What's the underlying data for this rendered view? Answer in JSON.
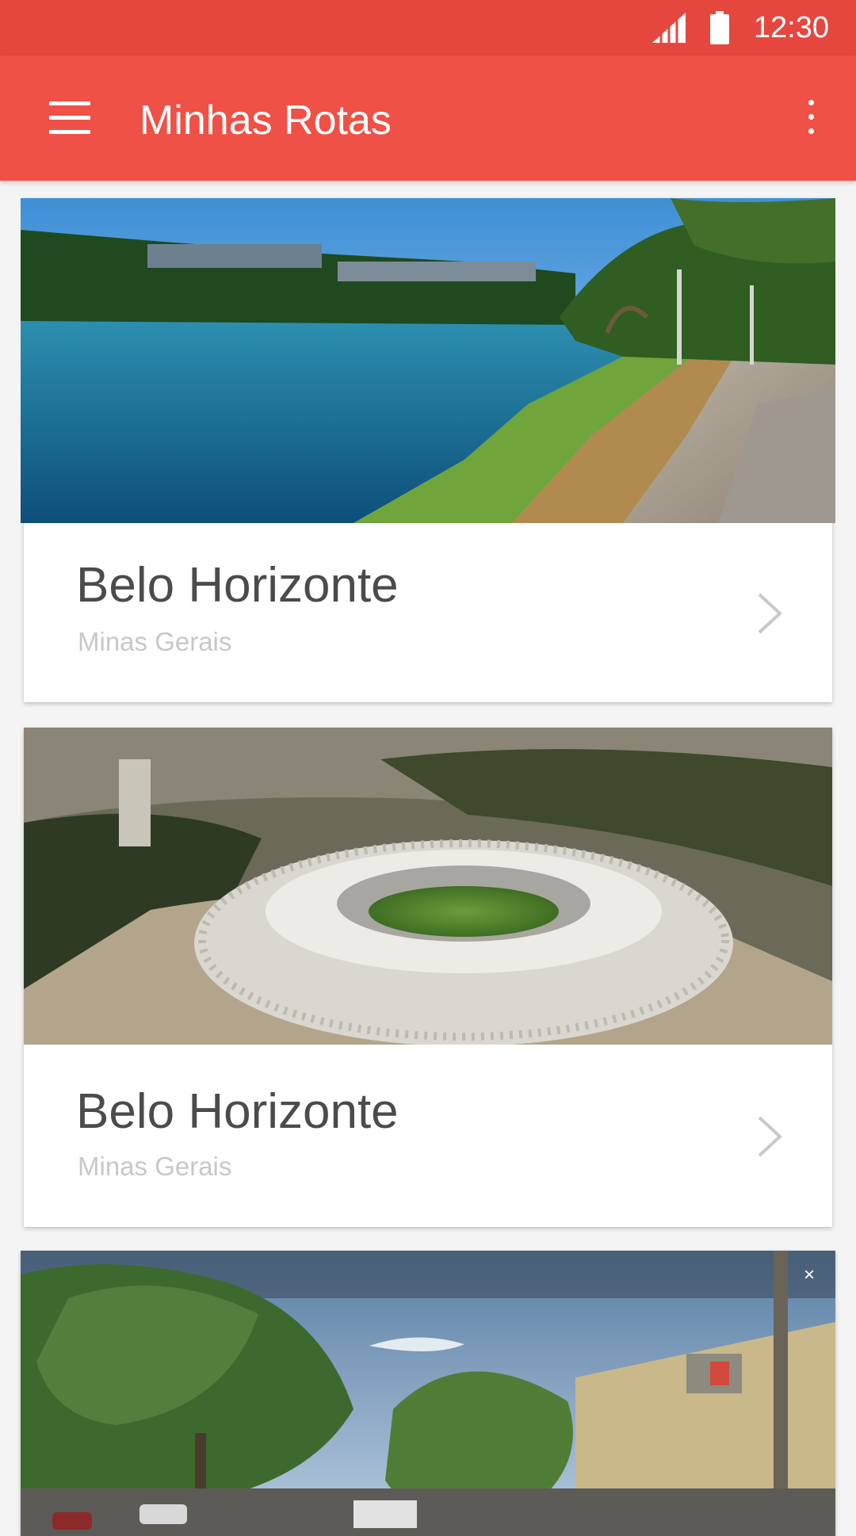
{
  "status_bar": {
    "time": "12:30",
    "icons": [
      "signal-icon",
      "battery-icon"
    ]
  },
  "app_bar": {
    "title": "Minhas Rotas",
    "icons": [
      "menu-icon",
      "overflow-menu-icon"
    ]
  },
  "cards": [
    {
      "title": "Belo Horizonte",
      "subtitle": "Minas Gerais",
      "image": "lake-pampulha-photo"
    },
    {
      "title": "Belo Horizonte",
      "subtitle": "Minas Gerais",
      "image": "mineirao-stadium-photo"
    },
    {
      "title": "",
      "subtitle": "",
      "image": "street-view-photo"
    }
  ],
  "colors": {
    "status_bar": "#e5473f",
    "app_bar": "#ef5146",
    "background": "#f4f4f4"
  }
}
